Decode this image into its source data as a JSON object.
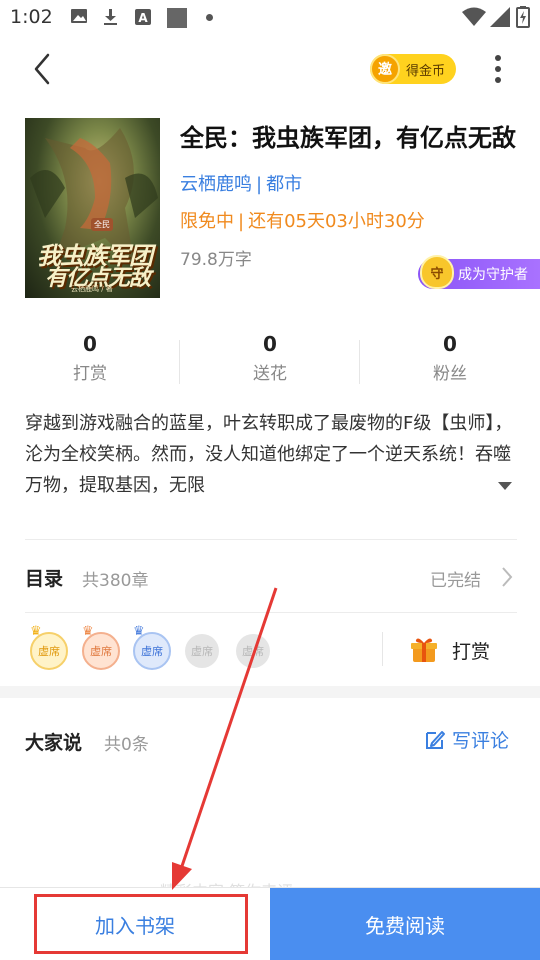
{
  "status_bar": {
    "time": "1:02",
    "icons": [
      "image-icon",
      "download-icon",
      "a-icon",
      "square-icon",
      "dot-icon",
      "wifi-icon",
      "signal-icon",
      "battery-icon"
    ]
  },
  "nav": {
    "coin_badge_char": "邀",
    "coin_label": "得金币"
  },
  "book": {
    "title": "全民：我虫族军团，有亿点无敌",
    "cover_tag": "全民",
    "cover_title_line1": "我虫族军团",
    "cover_title_line2": "有亿点无敌",
    "cover_author": "云栖鹿鸣 / 著",
    "author": "云栖鹿鸣",
    "separator": "|",
    "category": "都市",
    "promo": "限免中",
    "promo_remaining": "还有05天03小时30分",
    "word_count": "79.8万字",
    "guard_char": "守",
    "guard_label": "成为守护者"
  },
  "stats": [
    {
      "value": "0",
      "label": "打赏"
    },
    {
      "value": "0",
      "label": "送花"
    },
    {
      "value": "0",
      "label": "粉丝"
    }
  ],
  "synopsis": "穿越到游戏融合的蓝星，叶玄转职成了最废物的F级【虫师】，沦为全校笑柄。然而，没人知道他绑定了一个逆天系统！吞噬万物，提取基因，无限",
  "toc": {
    "label": "目录",
    "count": "共380章",
    "status": "已完结"
  },
  "tippers": {
    "seats": [
      "虚席",
      "虚席",
      "虚席",
      "虚席",
      "虚席"
    ],
    "tip_label": "打赏"
  },
  "comments": {
    "label": "大家说",
    "count": "共0条",
    "write_label": "写评论"
  },
  "bottom": {
    "faded_text": "精彩内容 等你来评",
    "shelf_label": "加入书架",
    "read_label": "免费阅读"
  },
  "colors": {
    "accent_blue": "#3a7fe0",
    "read_button": "#4a8ef0",
    "promo_orange": "#f08a1e",
    "annotation_red": "#e53935",
    "guard_purple": "#8b55f7",
    "coin_yellow": "#ffd21e"
  }
}
